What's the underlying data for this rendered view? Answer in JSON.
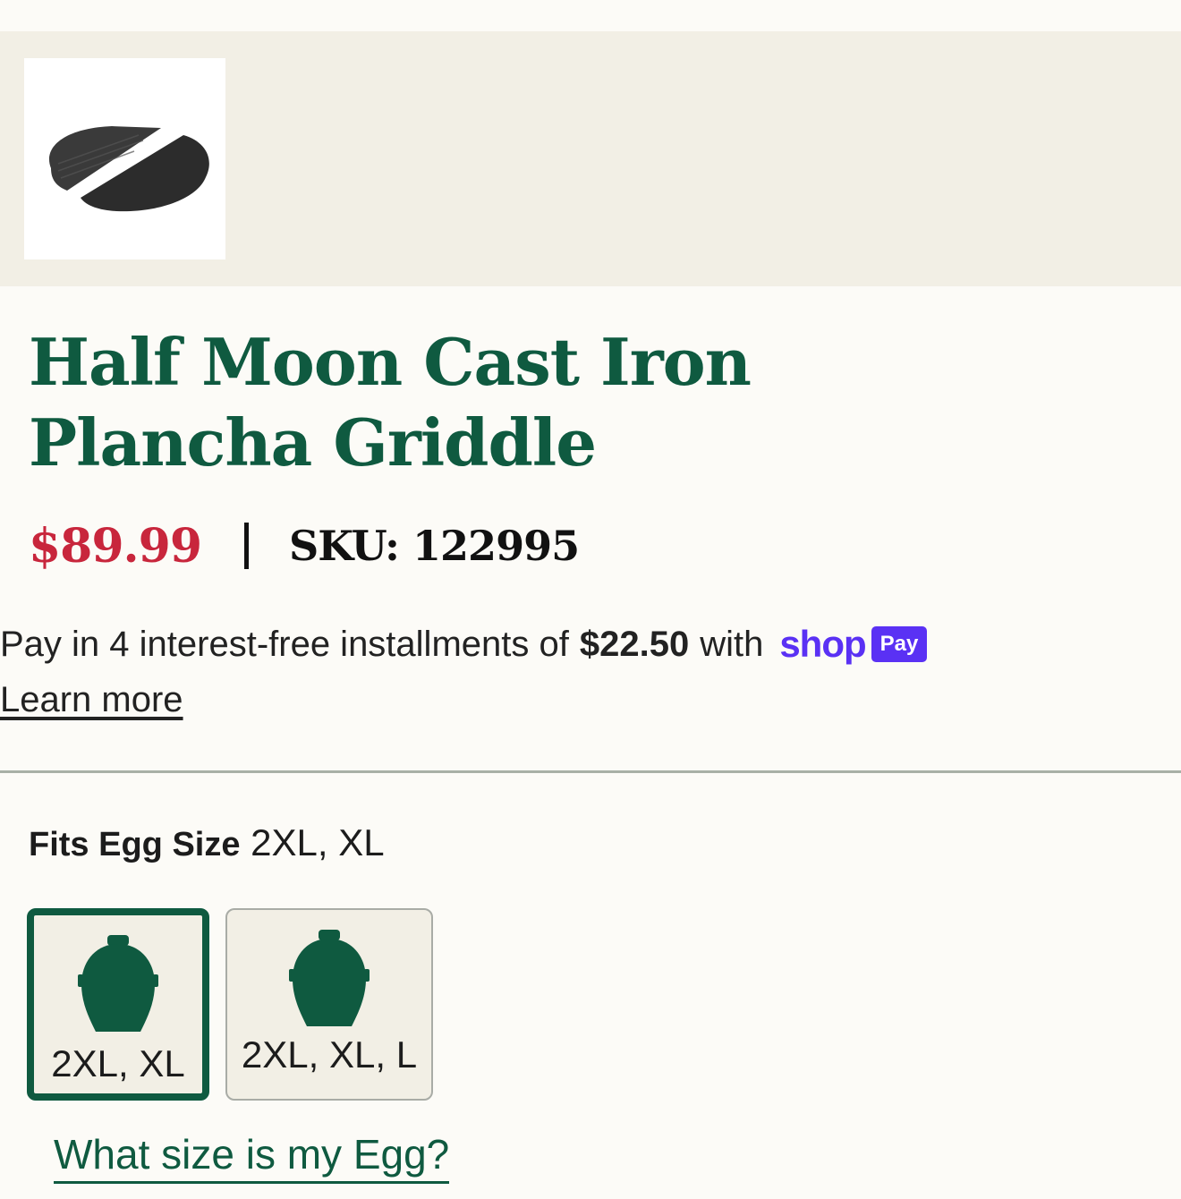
{
  "product": {
    "title": "Half Moon Cast Iron Plancha Griddle",
    "price": "$89.99",
    "sku_label": "SKU: 122995"
  },
  "installments": {
    "text_before": "Pay in 4 interest-free installments of",
    "amount": "$22.50",
    "text_after": "with",
    "brand_word": "shop",
    "brand_badge": "Pay",
    "learn_more": "Learn more"
  },
  "fit": {
    "label": "Fits Egg Size",
    "value": "2XL, XL"
  },
  "size_options": [
    {
      "label": "2XL, XL",
      "selected": true
    },
    {
      "label": "2XL, XL, L",
      "selected": false
    }
  ],
  "size_help_link": "What size is my Egg?",
  "colors": {
    "brand_green": "#0f5a40",
    "price_red": "#c8263c",
    "shop_pay_purple": "#5a31f4",
    "panel_beige": "#f2efe5"
  },
  "icons": {
    "thumbnail": "griddle-thumbnail",
    "size_option": "egg-icon"
  }
}
